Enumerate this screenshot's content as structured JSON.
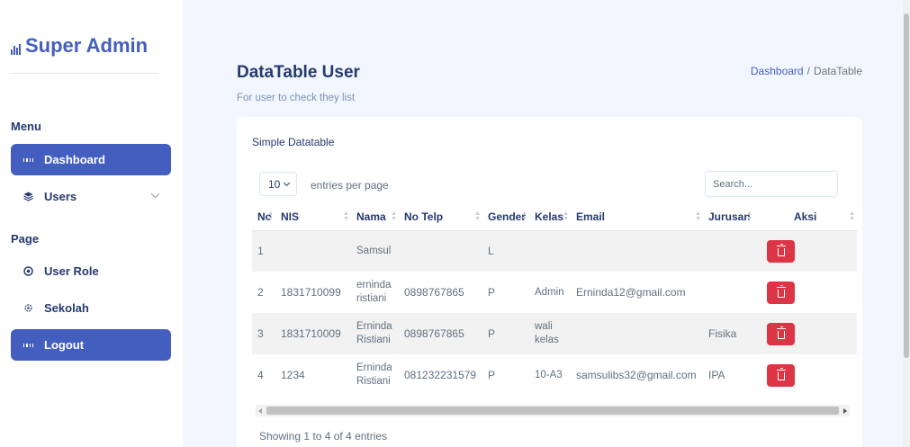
{
  "sidebar": {
    "logo": "Super Admin",
    "menu_title": "Menu",
    "page_title": "Page",
    "items": [
      {
        "label": "Dashboard"
      },
      {
        "label": "Users"
      },
      {
        "label": "User Role"
      },
      {
        "label": "Sekolah"
      },
      {
        "label": "Logout"
      }
    ]
  },
  "header": {
    "title": "DataTable User",
    "subtitle": "For user to check they list",
    "breadcrumb": {
      "link": "Dashboard",
      "sep": "/",
      "current": "DataTable"
    }
  },
  "card": {
    "title": "Simple Datatable",
    "per_page_value": "10",
    "per_page_label": "entries per page",
    "search_placeholder": "Search...",
    "footer": "Showing 1 to 4 of 4 entries"
  },
  "table": {
    "columns": [
      "No",
      "NIS",
      "Nama",
      "No Telp",
      "Gender",
      "Kelas",
      "Email",
      "Jurusan",
      "Aksi"
    ],
    "rows": [
      {
        "no": "1",
        "nis": "",
        "nama": "Samsul",
        "telp": "",
        "gender": "L",
        "kelas": "",
        "email": "",
        "jurusan": ""
      },
      {
        "no": "2",
        "nis": "1831710099",
        "nama": "erninda ristiani",
        "telp": "0898767865",
        "gender": "P",
        "kelas": "Admin",
        "email": "Erninda12@gmail.com",
        "jurusan": ""
      },
      {
        "no": "3",
        "nis": "1831710009",
        "nama": "Erninda Ristiani",
        "telp": "0898767865",
        "gender": "P",
        "kelas": "wali kelas",
        "email": "",
        "jurusan": "Fisika"
      },
      {
        "no": "4",
        "nis": "1234",
        "nama": "Erninda Ristiani",
        "telp": "081232231579",
        "gender": "P",
        "kelas": "10-A3",
        "email": "samsulibs32@gmail.com",
        "jurusan": "IPA"
      }
    ]
  },
  "colors": {
    "primary": "#435ebe",
    "danger": "#dc3545",
    "background": "#f2f7ff"
  }
}
